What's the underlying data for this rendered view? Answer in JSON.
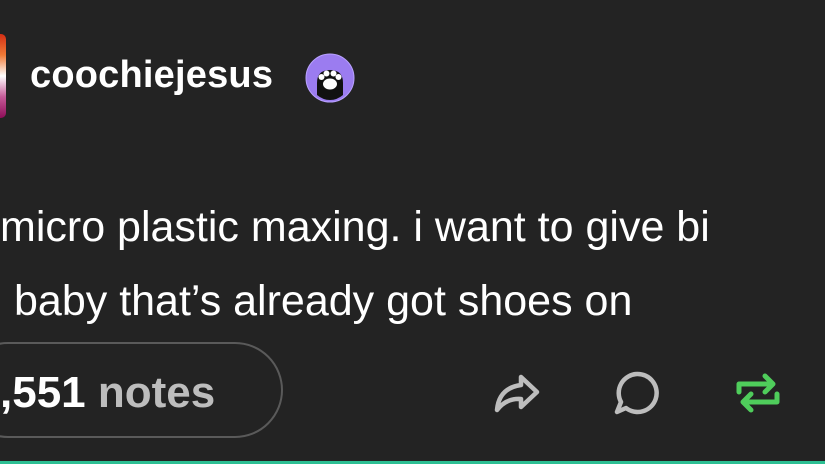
{
  "post": {
    "author": {
      "username": "coochiejesus",
      "badge_icon": "paw-print-icon"
    },
    "text_lines": [
      "micro plastic maxing. i want to give bi",
      "baby that’s already got shoes on"
    ]
  },
  "footer": {
    "notes_count": ",551",
    "notes_label": "notes",
    "actions": [
      "share-icon",
      "reply-icon",
      "reblog-icon"
    ]
  },
  "colors": {
    "background": "#232323",
    "text": "#ffffff",
    "muted": "#bdbdbd",
    "reblog": "#4fcd5b",
    "accent_line": "#2dbf93",
    "badge": "#9b7cf0"
  }
}
